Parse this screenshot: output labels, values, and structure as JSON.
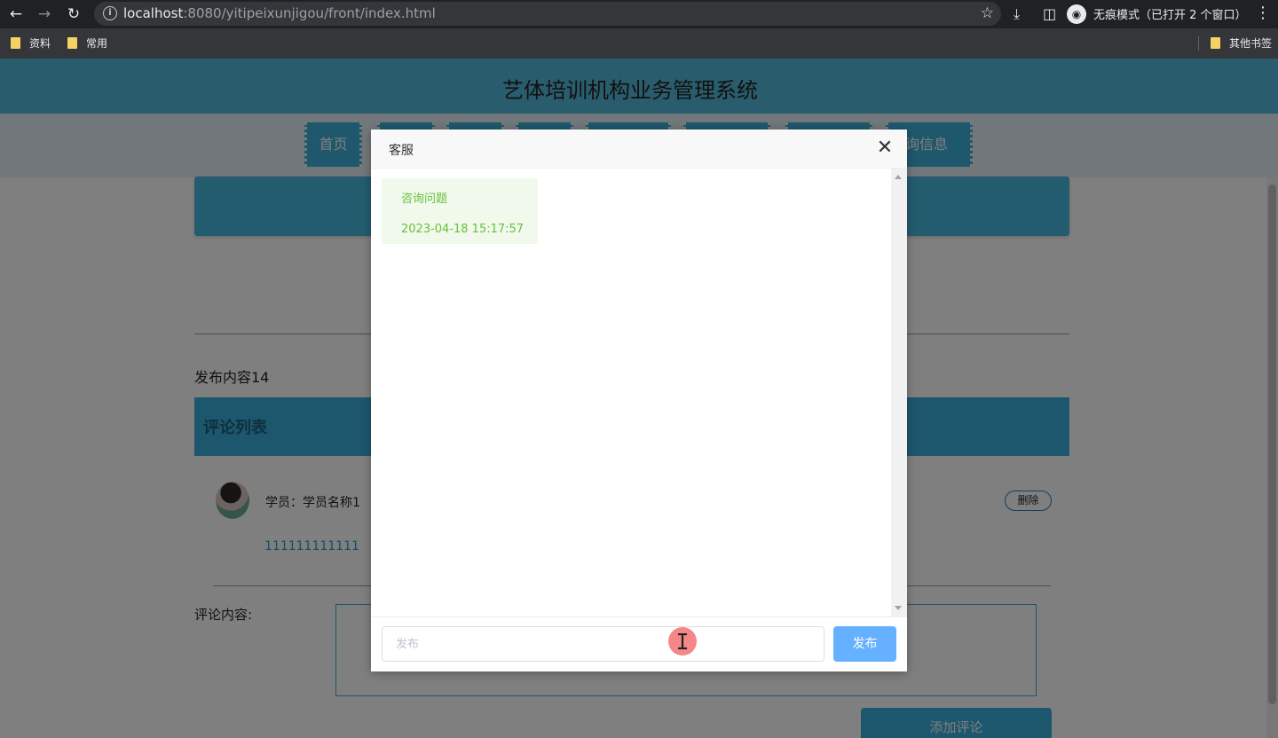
{
  "browser": {
    "url_host": "localhost",
    "url_rest": ":8080/yitipeixunjigou/front/index.html",
    "incognito_label": "无痕模式（已打开 2 个窗口）",
    "bookmarks": [
      "资料",
      "常用"
    ],
    "other_bookmarks": "其他书签"
  },
  "site": {
    "title": "艺体培训机构业务管理系统",
    "nav": [
      "首页",
      "",
      "",
      "",
      "",
      "",
      "",
      "咨询信息"
    ]
  },
  "post": {
    "content": "发布内容14",
    "comments_title": "评论列表",
    "comment": {
      "student": "学员：学员名称1",
      "text": "111111111111",
      "delete_label": "删除"
    },
    "comment_form_label": "评论内容:",
    "add_comment_label": "添加评论"
  },
  "dialog": {
    "title": "客服",
    "messages": [
      {
        "text": "咨询问题",
        "time": "2023-04-18 15:17:57"
      }
    ],
    "input_placeholder": "发布",
    "send_label": "发布"
  },
  "colors": {
    "header": "#52b8d8",
    "nav_active": "#3eb0d8",
    "message_bg": "#f0f9eb",
    "message_text": "#67c23a",
    "send_button": "#66b1ff"
  }
}
